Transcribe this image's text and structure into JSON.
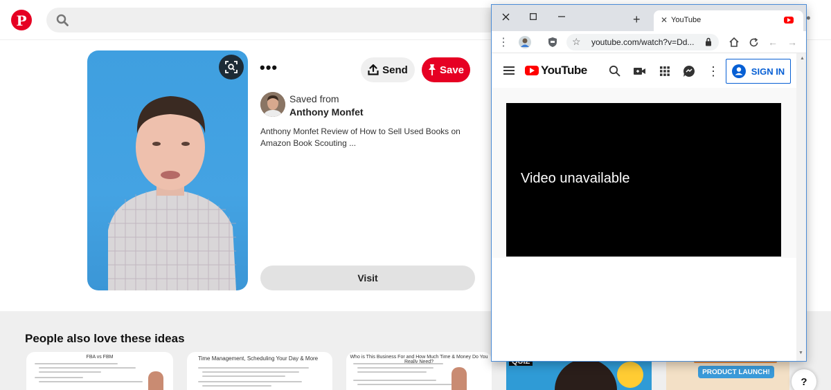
{
  "pinterest": {
    "logo_glyph": "P",
    "search_placeholder": "",
    "pin": {
      "more_label": "•••",
      "send_label": "Send",
      "save_label": "Save",
      "saved_from_label": "Saved from",
      "author": "Anthony Monfet",
      "description": "Anthony Monfet Review of How to Sell Used Books on Amazon Book Scouting ...",
      "visit_label": "Visit"
    },
    "related": {
      "title": "People also love these ideas",
      "thumbs": [
        {
          "title": "FBA vs FBM"
        },
        {
          "title": "Time Management, Scheduling Your Day & More"
        },
        {
          "title": "Who is This Business For and How Much Time & Money Do You Really Need?"
        },
        {
          "title": "QUIZ"
        },
        {
          "title": "PRODUCT LAUNCH!"
        }
      ]
    },
    "help_label": "?",
    "brand_color": "#e60023"
  },
  "browser": {
    "tab_title": "YouTube",
    "new_tab_label": "+",
    "url": "youtube.com/watch?v=Dd...",
    "youtube": {
      "logo_text": "YouTube",
      "signin_label": "SIGN IN",
      "video_message": "Video unavailable"
    }
  }
}
